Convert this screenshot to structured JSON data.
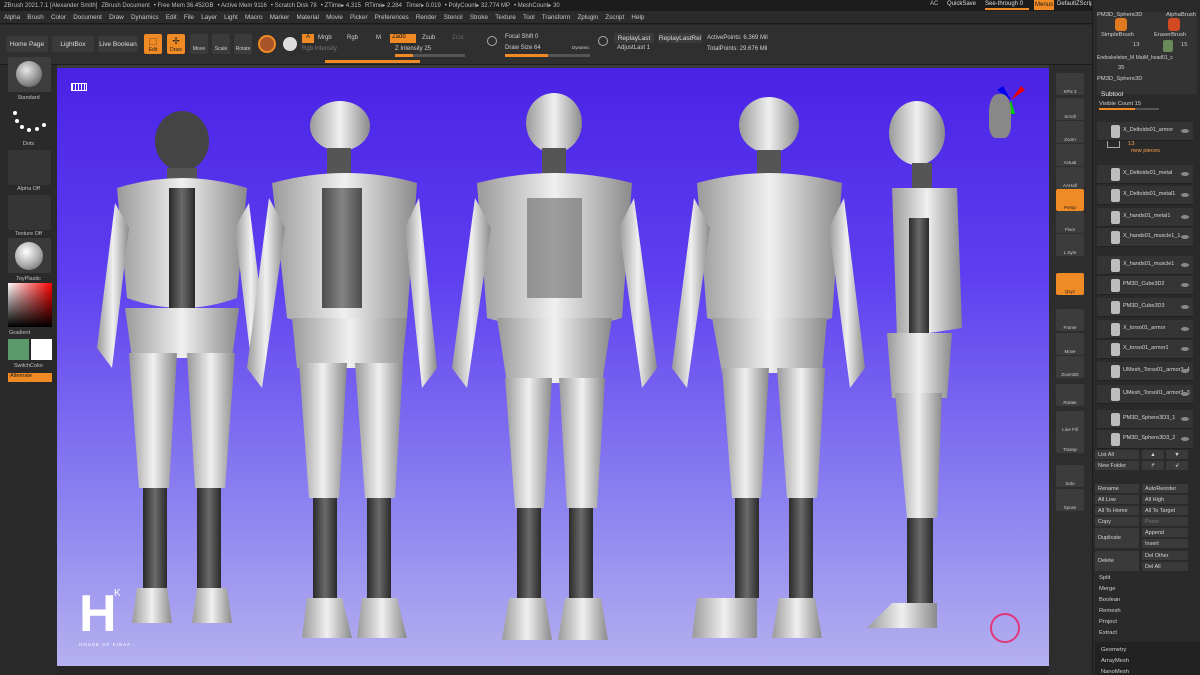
{
  "titlebar": {
    "app": "ZBrush 2021.7.1 [Alexander Smith]",
    "document": "ZBrush Document",
    "free_mem": "• Free Mem 36.452GB",
    "active_mem": "• Active Mem 9116",
    "scratch": "• Scratch Disk 78",
    "ztime": "• ZTime▸ 4.315",
    "rtime": "RTime▸ 2.284",
    "timer": "Timer▸ 0.019",
    "polycount": "• PolyCount▸ 32.774 MP",
    "meshcount": "• MeshCount▸ 30",
    "ac": "AC",
    "quicksave": "QuickSave",
    "seethrough": "See-through  0",
    "menus": "Menus",
    "script": "DefaultZScript"
  },
  "menu": [
    "Alpha",
    "Brush",
    "Color",
    "Document",
    "Draw",
    "Dynamics",
    "Edit",
    "File",
    "Layer",
    "Light",
    "Macro",
    "Marker",
    "Material",
    "Movie",
    "Picker",
    "Preferences",
    "Render",
    "Stencil",
    "Stroke",
    "Texture",
    "Tool",
    "Transform",
    "Zplugin",
    "Zscript",
    "Help"
  ],
  "shelf": {
    "home": "Home Page",
    "lightbox": "LightBox",
    "liveboolean": "Live Boolean",
    "edit": "Edit",
    "draw": "Draw",
    "move": "Move",
    "scale": "Scale",
    "rotate": "Rotate",
    "a": "A",
    "mrgb": "Mrgb",
    "rgb": "Rgb",
    "m": "M",
    "zadd": "Zadd",
    "zsub": "Zsub",
    "zcut": "Zcut",
    "rgb_intensity": "Rgb Intensity",
    "z_intensity": "Z Intensity 25",
    "focal_shift": "Focal Shift 0",
    "draw_size": "Draw Size 64",
    "dynamic": "Dynamic",
    "replay_last": "ReplayLast",
    "replay_last_rel": "ReplayLastRel",
    "adjust_last": "AdjustLast 1",
    "active_points": "ActivePoints: 6.369 Mil",
    "total_points": "TotalPoints: 29.676 Mil"
  },
  "levels": {
    "z_intensity": 0.25,
    "draw_size": 0.5
  },
  "left_tray": {
    "standard": "Standard",
    "dots": "Dots",
    "alpha_off": "Alpha Off",
    "texture_off": "Texture Off",
    "material": "ToyPlastic",
    "gradient": "Gradient",
    "switchcolor": "SwitchColor",
    "alternate": "Alternate"
  },
  "right_tray": [
    "SPix 3",
    "Scroll",
    "Zoom",
    "Actual",
    "AAHalf",
    "Persp",
    "Floor",
    "L.Sym",
    "Qxyz",
    "Frame",
    "Move",
    "Zoom3D",
    "Rotate",
    "Line Fill",
    "Transp",
    "Solo",
    "Xpose"
  ],
  "right_panel": {
    "brush1": "SimpleBrush",
    "brush2": "EraserBrush",
    "brush3": "AlphaBrush",
    "sphere_top": "PM3D_Sphere3D",
    "count1": "13",
    "count2": "15",
    "endo": "Endoskeleton_M  MatM_head01_c",
    "count3": "35",
    "sphere_label": "PM3D_Sphere3D",
    "subtool": "Subtool",
    "visible_count": "Visible Count 15",
    "new_pieces_num": "13",
    "new_pieces": "new pieces",
    "items": [
      "X_Deltoids01_armor",
      "X_Deltoids01_metal",
      "X_Deltoids01_metal1",
      "X_hands01_metal1",
      "X_hands01_muscle1_1",
      "X_hands01_muscle1",
      "PM3D_Cube3D2",
      "PM3D_Cube3D3",
      "X_torso01_armor",
      "X_torso01_armor1",
      "UMesh_Torso01_armor3_4",
      "UMesh_Torso01_armor3_3",
      "PM3D_Sphere3D3_1",
      "PM3D_Sphere3D3_2"
    ],
    "list_all": "List All",
    "new_folder": "New Folder",
    "rename": "Rename",
    "autoreorder": "AutoReorder",
    "all_low": "All Low",
    "all_high": "All High",
    "all_to_home": "All To Home",
    "all_to_target": "All To Target",
    "copy": "Copy",
    "paste": "Paste",
    "duplicate": "Duplicate",
    "append": "Append",
    "insert": "Insert",
    "delete": "Delete",
    "del_other": "Del Other",
    "del_all": "Del All",
    "split": "Split",
    "merge": "Merge",
    "boolean": "Boolean",
    "remesh": "Remesh",
    "project": "Project",
    "extract": "Extract",
    "geometry": "Geometry",
    "arraymesh": "ArrayMesh",
    "nanomesh": "NanoMesh"
  },
  "watermark": {
    "letter": "H",
    "sup": "K",
    "text": "HOUSE OF KIBAA"
  }
}
